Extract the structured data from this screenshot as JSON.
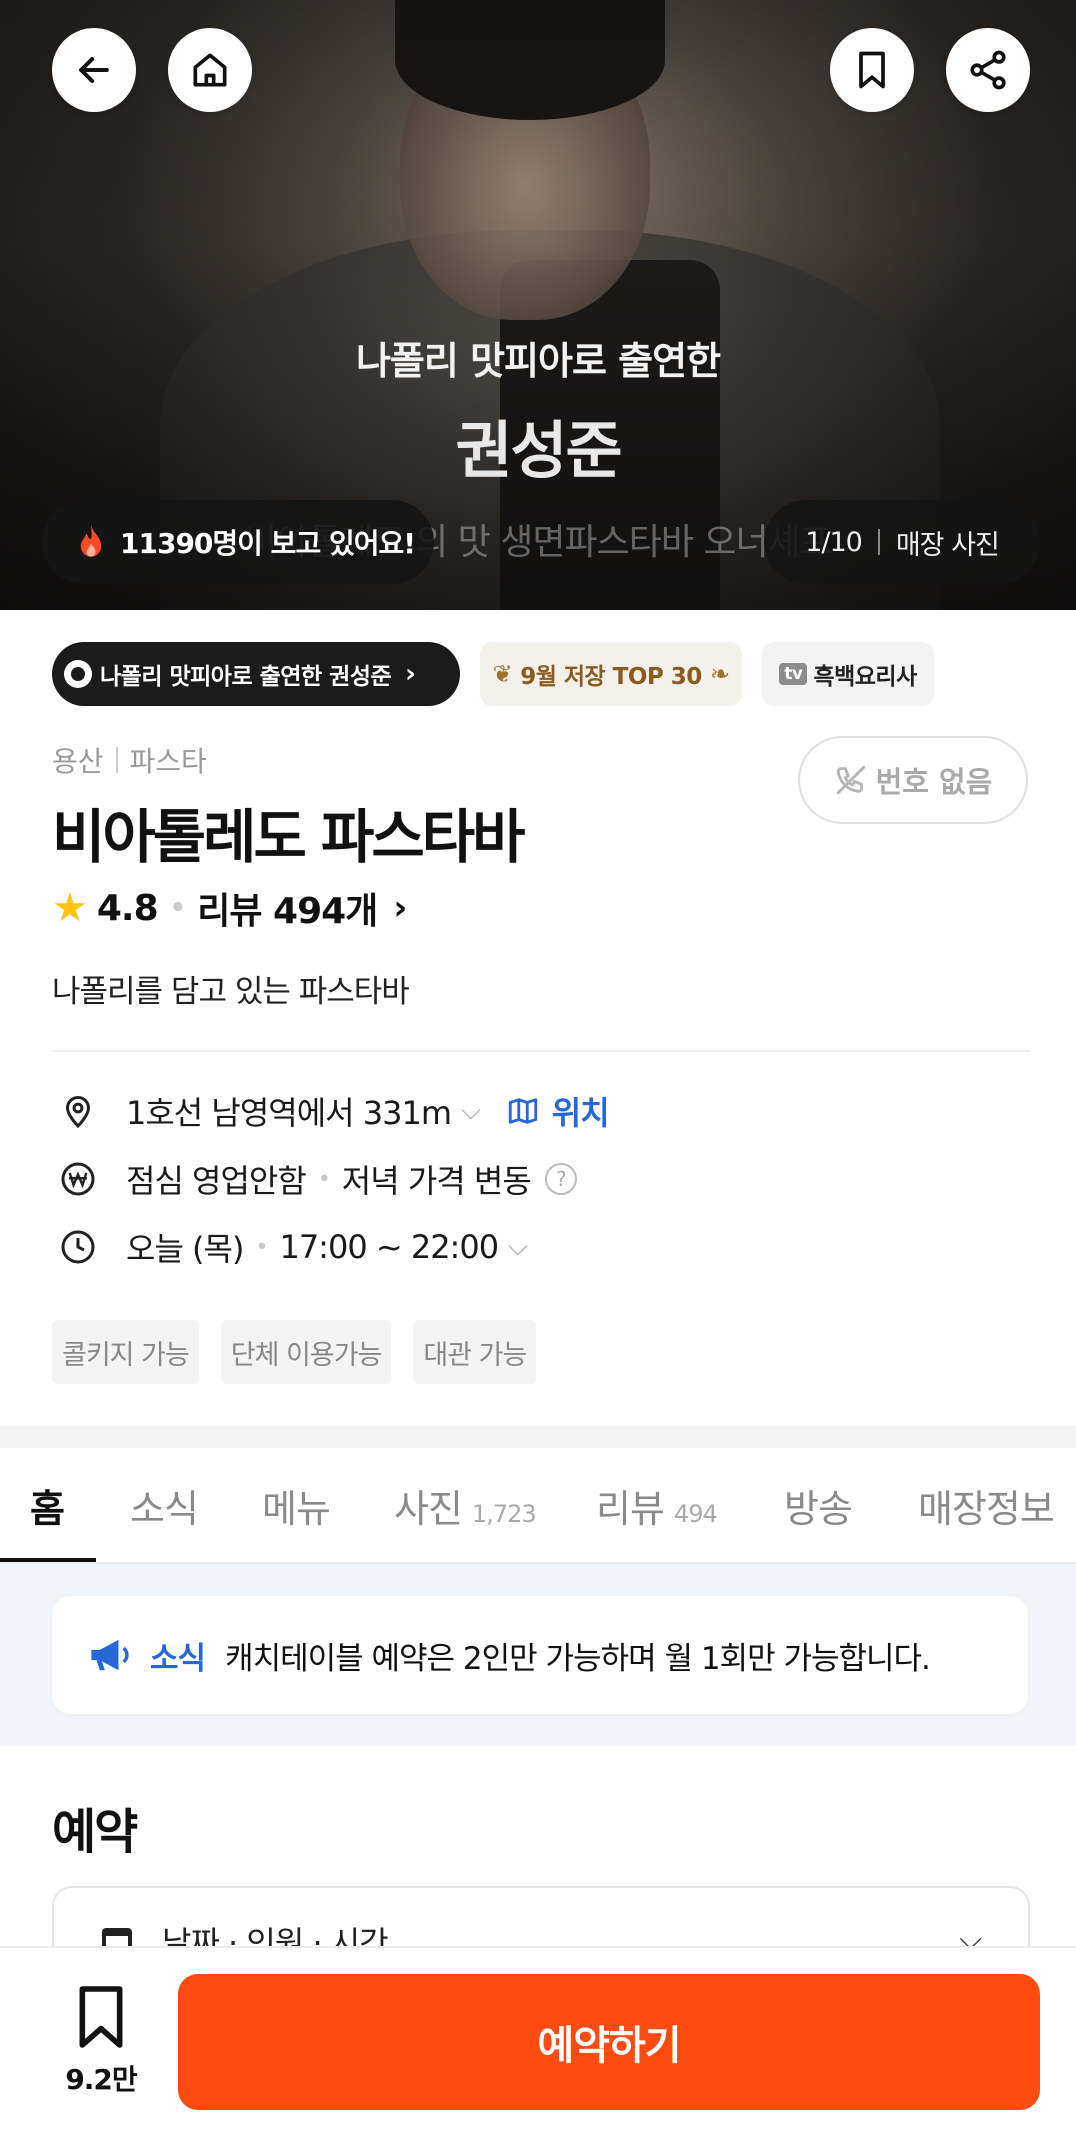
{
  "hero": {
    "caption": "나폴리 맛피아로 출연한",
    "name": "권성준",
    "subline": "비아톨레도 의 맛 생면파스타바 오너셰프",
    "viewers": "11390명이 보고 있어요!",
    "photo_counter": "1/10",
    "photo_label": "매장 사진"
  },
  "badges": {
    "feature": "나폴리 맛피아로 출연한 권성준",
    "top": "9월 저장 TOP 30",
    "tv_icon": "tv",
    "tv": "흑백요리사"
  },
  "restaurant": {
    "region": "용산",
    "category": "파스타",
    "name": "비아톨레도 파스타바",
    "rating": "4.8",
    "reviews": "리뷰 494개",
    "description": "나폴리를 담고 있는 파스타바",
    "phone_label": "번호 없음"
  },
  "info": {
    "distance": "1호선 남영역에서 331m",
    "location_link": "위치",
    "lunch": "점심 영업안함",
    "dinner": "저녁 가격 변동",
    "help": "?",
    "day": "오늘 (목)",
    "hours": "17:00 ~ 22:00"
  },
  "tags": [
    "콜키지 가능",
    "단체 이용가능",
    "대관 가능"
  ],
  "tabs": [
    {
      "label": "홈",
      "count": ""
    },
    {
      "label": "소식",
      "count": ""
    },
    {
      "label": "메뉴",
      "count": ""
    },
    {
      "label": "사진",
      "count": "1,723"
    },
    {
      "label": "리뷰",
      "count": "494"
    },
    {
      "label": "방송",
      "count": ""
    },
    {
      "label": "매장정보",
      "count": ""
    }
  ],
  "news": {
    "label": "소식",
    "text": "캐치테이블 예약은 2인만 가능하며 월 1회만 가능합니다."
  },
  "reservation": {
    "title": "예약",
    "selector": "날짜 · 인원 · 시간"
  },
  "bottom": {
    "save_count": "9.2만",
    "reserve_label": "예약하기"
  },
  "colors": {
    "accent": "#ff4a10",
    "link": "#2767d8",
    "star": "#ffc414"
  }
}
